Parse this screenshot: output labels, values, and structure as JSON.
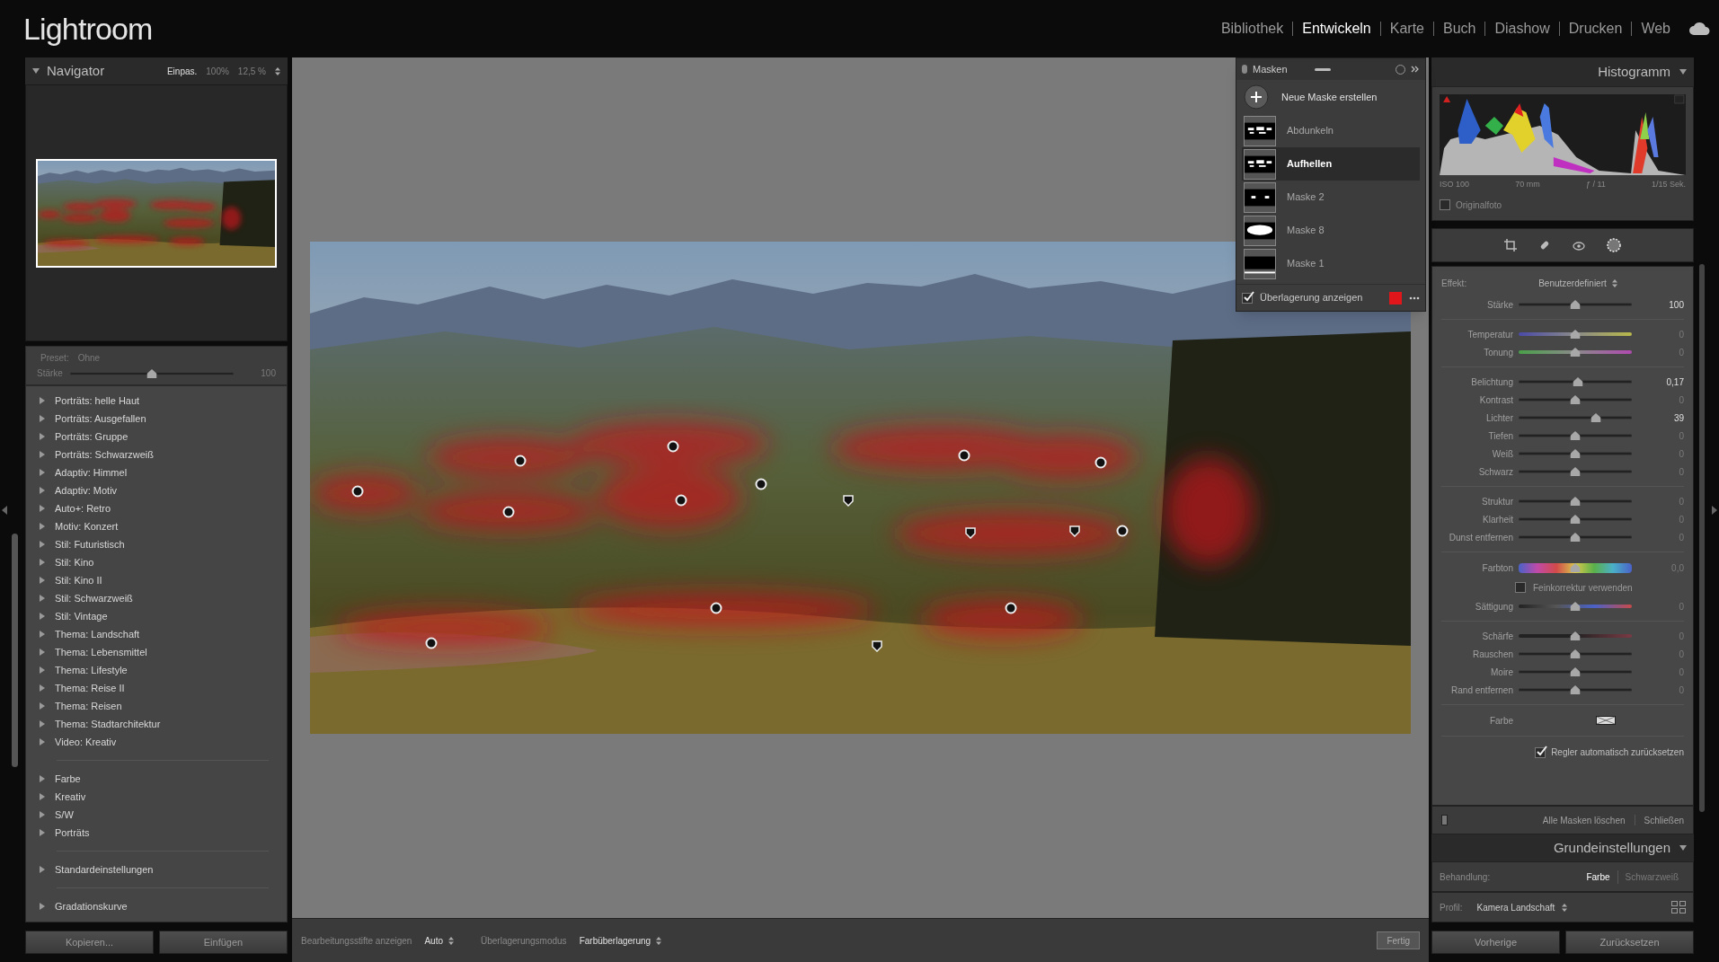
{
  "app": {
    "logo": "Lightroom",
    "modules": [
      {
        "label": "Bibliothek",
        "selected": false
      },
      {
        "label": "Entwickeln",
        "selected": true
      },
      {
        "label": "Karte",
        "selected": false
      },
      {
        "label": "Buch",
        "selected": false
      },
      {
        "label": "Diashow",
        "selected": false
      },
      {
        "label": "Drucken",
        "selected": false
      },
      {
        "label": "Web",
        "selected": false
      }
    ]
  },
  "navigator": {
    "title": "Navigator",
    "zoom_options": [
      {
        "label": "Einpas.",
        "selected": true
      },
      {
        "label": "100%",
        "selected": false
      },
      {
        "label": "12,5 %",
        "selected": false
      }
    ]
  },
  "preset": {
    "label": "Preset:",
    "value": "Ohne",
    "amount_label": "Stärke",
    "amount": "100",
    "level": 0.5
  },
  "preset_groups": [
    {
      "items": [
        "Porträts: helle Haut",
        "Porträts: Ausgefallen",
        "Porträts: Gruppe",
        "Porträts: Schwarzweiß",
        "Adaptiv: Himmel",
        "Adaptiv: Motiv",
        "Auto+: Retro",
        "Motiv: Konzert",
        "Stil: Futuristisch",
        "Stil: Kino",
        "Stil: Kino II",
        "Stil: Schwarzweiß",
        "Stil: Vintage",
        "Thema: Landschaft",
        "Thema: Lebensmittel",
        "Thema: Lifestyle",
        "Thema: Reise II",
        "Thema: Reisen",
        "Thema: Stadtarchitektur",
        "Video: Kreativ"
      ]
    },
    {
      "items": [
        "Farbe",
        "Kreativ",
        "S/W",
        "Porträts"
      ]
    },
    {
      "items": [
        "Standardeinstellungen"
      ]
    },
    {
      "items": [
        "Gradationskurve"
      ]
    }
  ],
  "left_buttons": [
    "Kopieren...",
    "Einfügen"
  ],
  "masks": {
    "title": "Masken",
    "new_mask": "Neue Maske erstellen",
    "items": [
      {
        "name": "Abdunkeln",
        "selected": false,
        "kind": "spots"
      },
      {
        "name": "Aufhellen",
        "selected": true,
        "kind": "spots"
      },
      {
        "name": "Maske 2",
        "selected": false,
        "kind": "dots"
      },
      {
        "name": "Maske 8",
        "selected": false,
        "kind": "ellipse"
      },
      {
        "name": "Maske 1",
        "selected": false,
        "kind": "band"
      }
    ],
    "overlay": {
      "label": "Überlagerung anzeigen",
      "checked": true,
      "color": "#e0161b"
    }
  },
  "histogram": {
    "title": "Histogramm",
    "info": [
      "ISO 100",
      "70 mm",
      "ƒ / 11",
      "1/15 Sek."
    ],
    "original": {
      "label": "Originalfoto",
      "checked": false
    }
  },
  "mask_settings": {
    "effect_label": "Effekt:",
    "effect": "Benutzerdefiniert",
    "groups": [
      {
        "rows": [
          {
            "kind": "plain",
            "label": "Stärke",
            "value": "100",
            "level": 0.5,
            "modified": true
          }
        ]
      },
      {
        "rows": [
          {
            "kind": "temp",
            "label": "Temperatur",
            "value": "0",
            "level": 0.5,
            "modified": false
          },
          {
            "kind": "tint",
            "label": "Tonung",
            "value": "0",
            "level": 0.5,
            "modified": false
          }
        ]
      },
      {
        "rows": [
          {
            "kind": "plain",
            "label": "Belichtung",
            "value": "0,17",
            "level": 0.52,
            "modified": true
          },
          {
            "kind": "plain",
            "label": "Kontrast",
            "value": "0",
            "level": 0.5,
            "modified": false
          },
          {
            "kind": "plain",
            "label": "Lichter",
            "value": "39",
            "level": 0.68,
            "modified": true
          },
          {
            "kind": "plain",
            "label": "Tiefen",
            "value": "0",
            "level": 0.5,
            "modified": false
          },
          {
            "kind": "plain",
            "label": "Weiß",
            "value": "0",
            "level": 0.5,
            "modified": false
          },
          {
            "kind": "plain",
            "label": "Schwarz",
            "value": "0",
            "level": 0.5,
            "modified": false
          }
        ]
      },
      {
        "rows": [
          {
            "kind": "plain",
            "label": "Struktur",
            "value": "0",
            "level": 0.5,
            "modified": false
          },
          {
            "kind": "plain",
            "label": "Klarheit",
            "value": "0",
            "level": 0.5,
            "modified": false
          },
          {
            "kind": "plain",
            "label": "Dunst entfernen",
            "value": "0",
            "level": 0.5,
            "modified": false
          }
        ]
      },
      {
        "rows": [
          {
            "kind": "hue",
            "label": "Farbton",
            "value": "0,0",
            "level": 0.5,
            "modified": false
          },
          {
            "kind": "checkbox",
            "label": "Feinkorrektur verwenden",
            "checked": false
          },
          {
            "kind": "sat",
            "label": "Sättigung",
            "value": "0",
            "level": 0.5,
            "modified": false
          }
        ]
      },
      {
        "rows": [
          {
            "kind": "sharp",
            "label": "Schärfe",
            "value": "0",
            "level": 0.5,
            "modified": false
          },
          {
            "kind": "plain",
            "label": "Rauschen",
            "value": "0",
            "level": 0.5,
            "modified": false
          },
          {
            "kind": "plain",
            "label": "Moire",
            "value": "0",
            "level": 0.5,
            "modified": false
          },
          {
            "kind": "plain",
            "label": "Rand entfernen",
            "value": "0",
            "level": 0.5,
            "modified": false
          }
        ]
      },
      {
        "rows": [
          {
            "kind": "color",
            "label": "Farbe"
          }
        ]
      }
    ],
    "auto_reset": {
      "label": "Regler automatisch zurücksetzen",
      "checked": true
    },
    "delete_all": "Alle Masken löschen",
    "close": "Schließen"
  },
  "basic": {
    "title": "Grundeinstellungen",
    "treatment_label": "Behandlung:",
    "treatments": [
      {
        "label": "Farbe",
        "selected": true
      },
      {
        "label": "Schwarzweiß",
        "selected": false
      }
    ],
    "profile_label": "Profil:",
    "profile": "Kamera Landschaft"
  },
  "right_buttons": [
    "Vorherige",
    "Zurücksetzen"
  ],
  "toolbar": {
    "pins_label": "Bearbeitungsstifte anzeigen",
    "pins_value": "Auto",
    "overlay_label": "Überlagerungsmodus",
    "overlay_value": "Farbüberlagerung",
    "done": "Fertig"
  }
}
